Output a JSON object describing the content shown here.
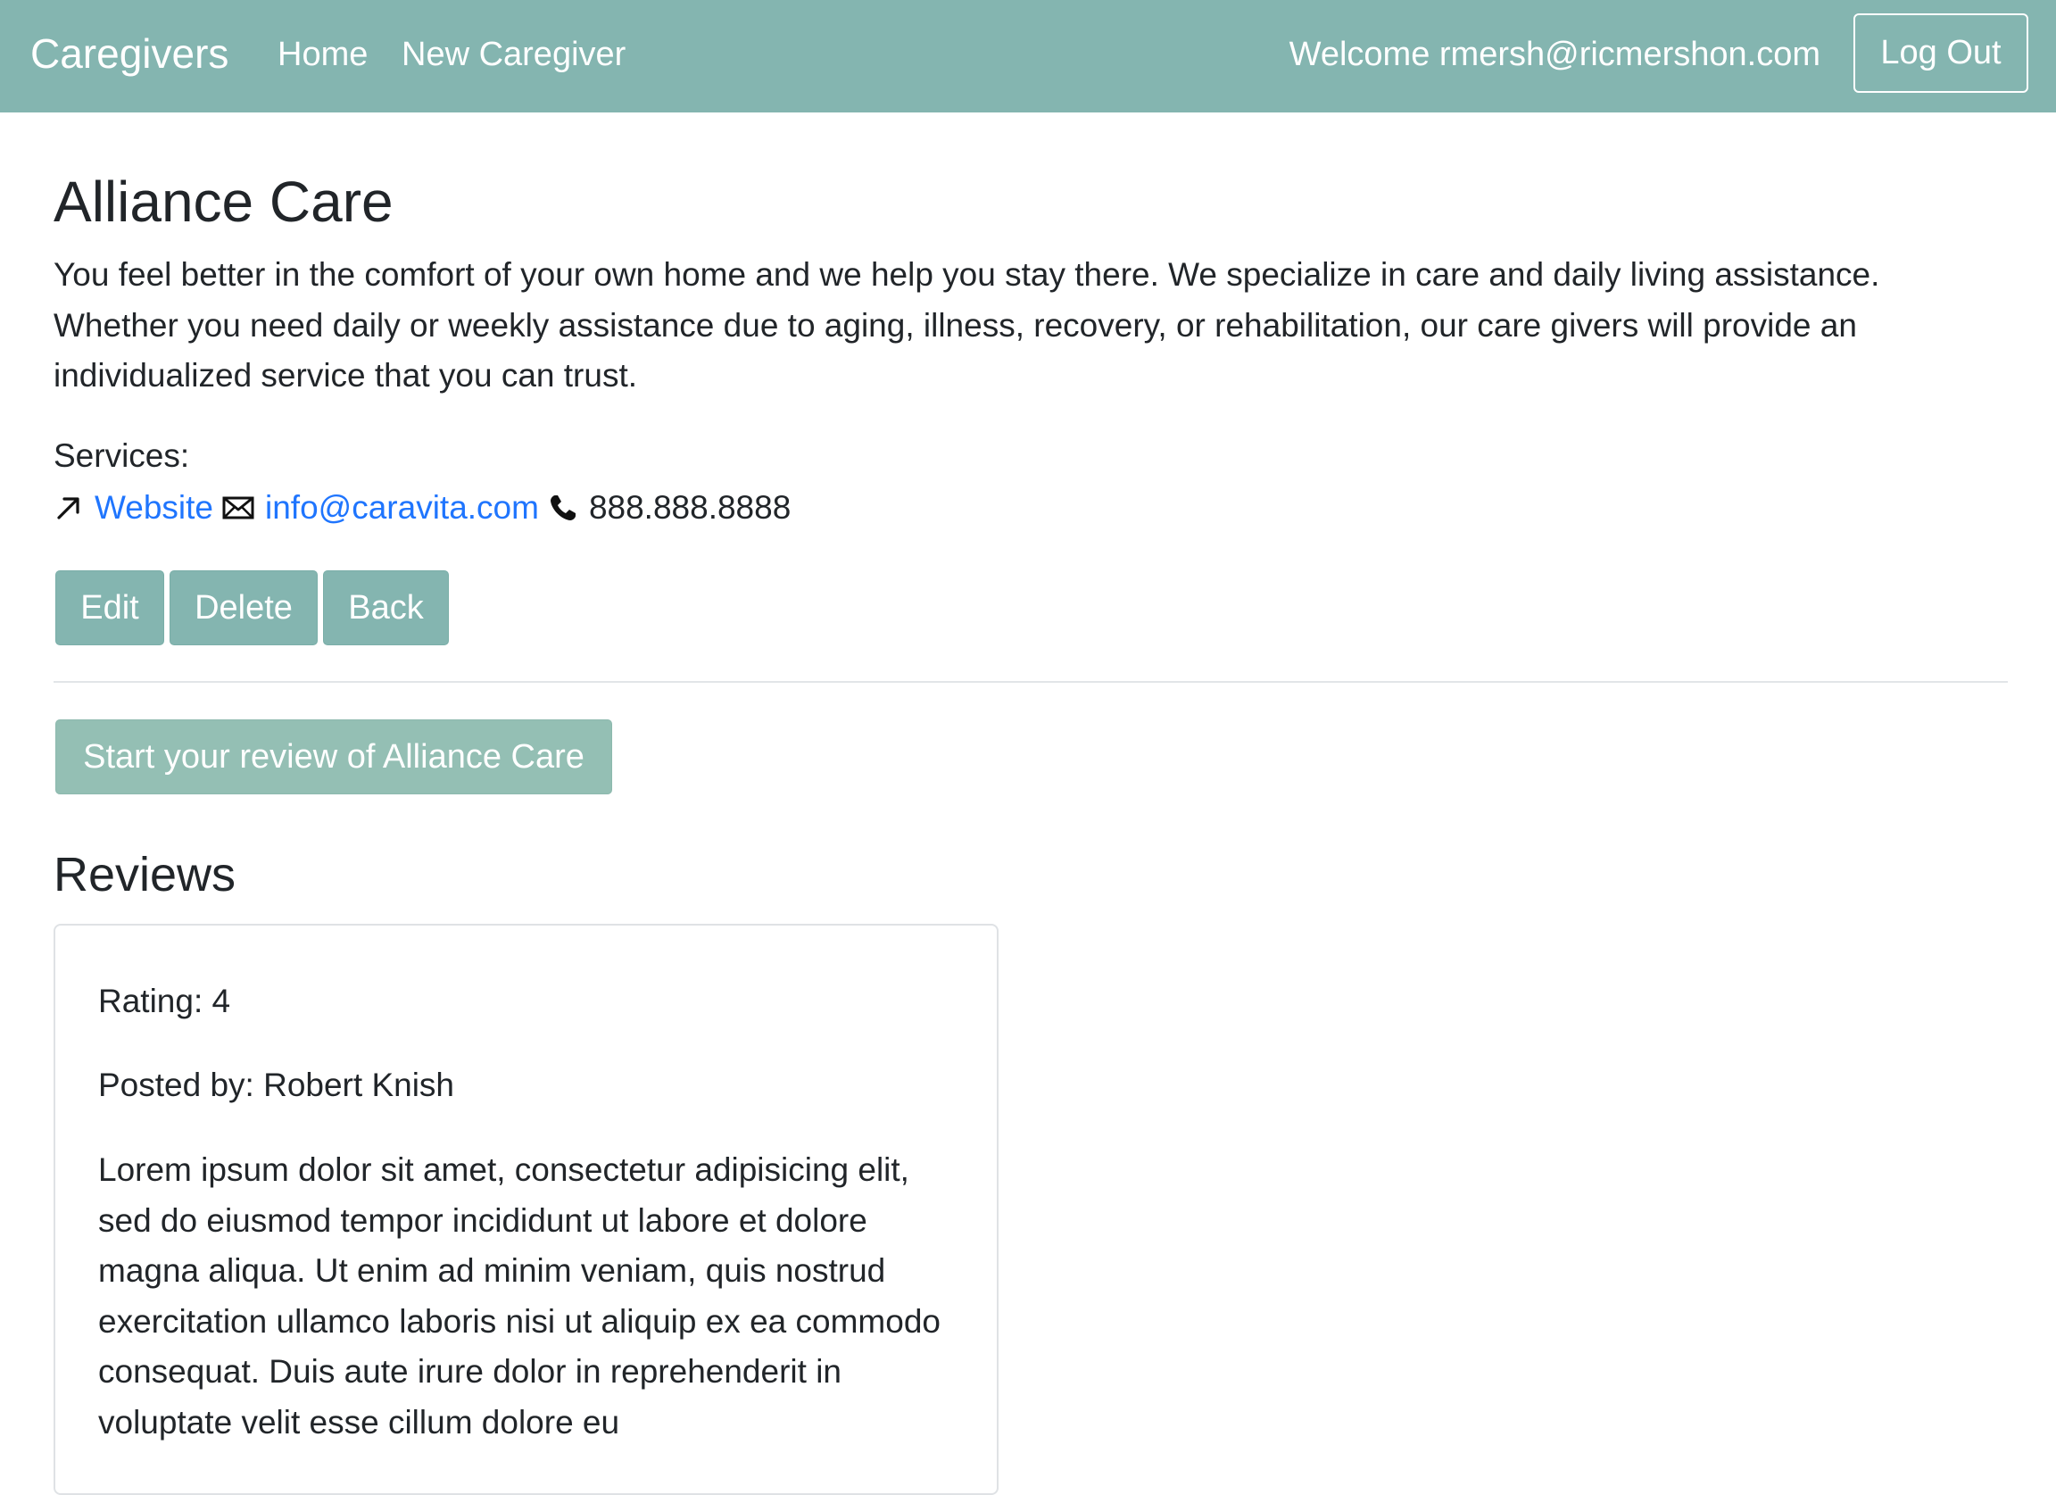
{
  "navbar": {
    "brand": "Caregivers",
    "links": [
      "Home",
      "New Caregiver"
    ],
    "welcome": "Welcome rmersh@ricmershon.com",
    "logout_label": "Log Out"
  },
  "caregiver": {
    "name": "Alliance Care",
    "description": "You feel better in the comfort of your own home and we help you stay there. We specialize in care and daily living assistance. Whether you need daily or weekly assistance due to aging, illness, recovery, or rehabilitation, our care givers will provide an individualized service that you can trust.",
    "services_label": "Services:",
    "website_label": "Website",
    "email": "info@caravita.com",
    "phone": "888.888.8888"
  },
  "actions": {
    "edit_label": "Edit",
    "delete_label": "Delete",
    "back_label": "Back"
  },
  "review_cta": {
    "label": "Start your review of Alliance Care"
  },
  "reviews": {
    "heading": "Reviews",
    "items": [
      {
        "rating": "Rating: 4",
        "posted_by": "Posted by: Robert Knish",
        "body": "Lorem ipsum dolor sit amet, consectetur adipisicing elit, sed do eiusmod tempor incididunt ut labore et dolore magna aliqua. Ut enim ad minim veniam, quis nostrud exercitation ullamco laboris nisi ut aliquip ex ea commodo consequat. Duis aute irure dolor in reprehenderit in voluptate velit esse cillum dolore eu"
      }
    ]
  },
  "colors": {
    "navbar": "#84b5b0",
    "button": "#84b5b0",
    "review_button": "#94bfb4",
    "link": "#1f75fe"
  },
  "icons": {
    "website": "arrow-up-right-icon",
    "email": "envelope-icon",
    "phone": "phone-icon"
  }
}
